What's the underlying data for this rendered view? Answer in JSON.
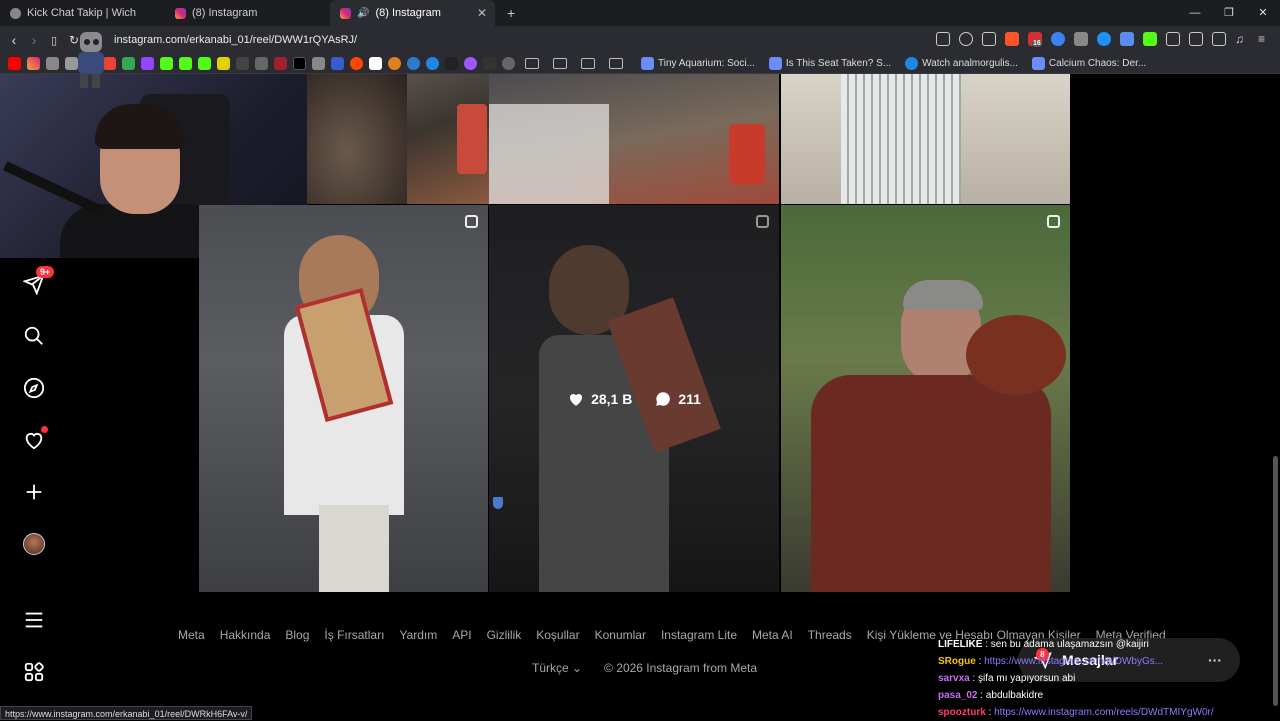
{
  "browser": {
    "tabs": [
      {
        "title": "Kick Chat Takip | Wich",
        "active": false
      },
      {
        "title": "(8) Instagram",
        "active": false
      },
      {
        "title": "(8) Instagram",
        "active": true
      }
    ],
    "url": "instagram.com/erkanabi_01/reel/DWW1rQYAsRJ/",
    "bookmarks": [
      {
        "label": "Tiny Aquarium: Soci..."
      },
      {
        "label": "Is This Seat Taken? S..."
      },
      {
        "label": "Watch analmorgulis..."
      },
      {
        "label": "Calcium Chaos: Der..."
      }
    ],
    "status_url": "https://www.instagram.com/erkanabi_01/reel/DWRkH6FAv-v/",
    "extension_badge": "16"
  },
  "sidebar": {
    "notifications_badge": "9+",
    "items": [
      {
        "name": "direct-icon"
      },
      {
        "name": "search-icon"
      },
      {
        "name": "explore-icon"
      },
      {
        "name": "heart-icon"
      },
      {
        "name": "create-icon"
      },
      {
        "name": "profile-avatar"
      },
      {
        "name": "menu-icon"
      },
      {
        "name": "apps-icon"
      }
    ]
  },
  "grid": {
    "hover_stats": {
      "likes": "28,1 B",
      "comments": "211"
    }
  },
  "footer": {
    "links": [
      "Meta",
      "Hakkında",
      "Blog",
      "İş Fırsatları",
      "Yardım",
      "API",
      "Gizlilik",
      "Koşullar",
      "Konumlar",
      "Instagram Lite",
      "Meta AI",
      "Threads",
      "Kişi Yükleme ve Hesabı Olmayan Kişiler",
      "Meta Verified"
    ],
    "language": "Türkçe",
    "copyright": "© 2026 Instagram from Meta"
  },
  "messages_pill": {
    "label": "Mesajlar",
    "badge": "8"
  },
  "chat": [
    {
      "user": "LIFELIKE",
      "text": " sen bu adama ulaşamazsın @kaijiri",
      "link": ""
    },
    {
      "user": "SRogue",
      "text": " ",
      "link": "https://www.instagram.com/p/DWbyGs..."
    },
    {
      "user": "sarvxa",
      "text": " şifa mı yapıyorsun abi",
      "link": ""
    },
    {
      "user": "pasa_02",
      "text": " abdulbakidre",
      "link": ""
    },
    {
      "user": "spoozturk",
      "text": " ",
      "link": "https://www.instagram.com/reels/DWdTMIYgW0r/"
    }
  ]
}
